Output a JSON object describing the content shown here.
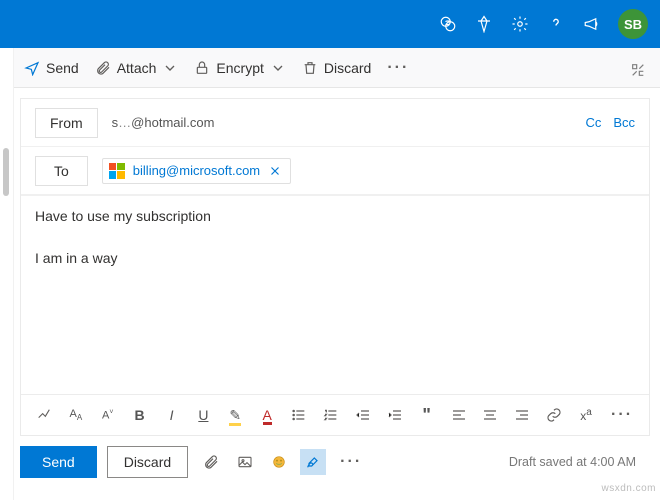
{
  "header": {
    "avatar_initials": "SB"
  },
  "command": {
    "send": "Send",
    "attach": "Attach",
    "encrypt": "Encrypt",
    "discard": "Discard"
  },
  "compose": {
    "from_label": "From",
    "from_email_prefix": "s",
    "from_email_masked": "…",
    "from_email_domain": "@hotmail.com",
    "cc": "Cc",
    "bcc": "Bcc",
    "to_label": "To",
    "to_recipient": "billing@microsoft.com",
    "subject": "Have to use my subscription",
    "body_line1": "I am in a way"
  },
  "format": {
    "b": "B",
    "i": "I",
    "u": "U",
    "a": "A",
    "quote": "\""
  },
  "footer": {
    "send": "Send",
    "discard": "Discard",
    "status": "Draft saved at 4:00 AM"
  },
  "watermark": "wsxdn.com"
}
